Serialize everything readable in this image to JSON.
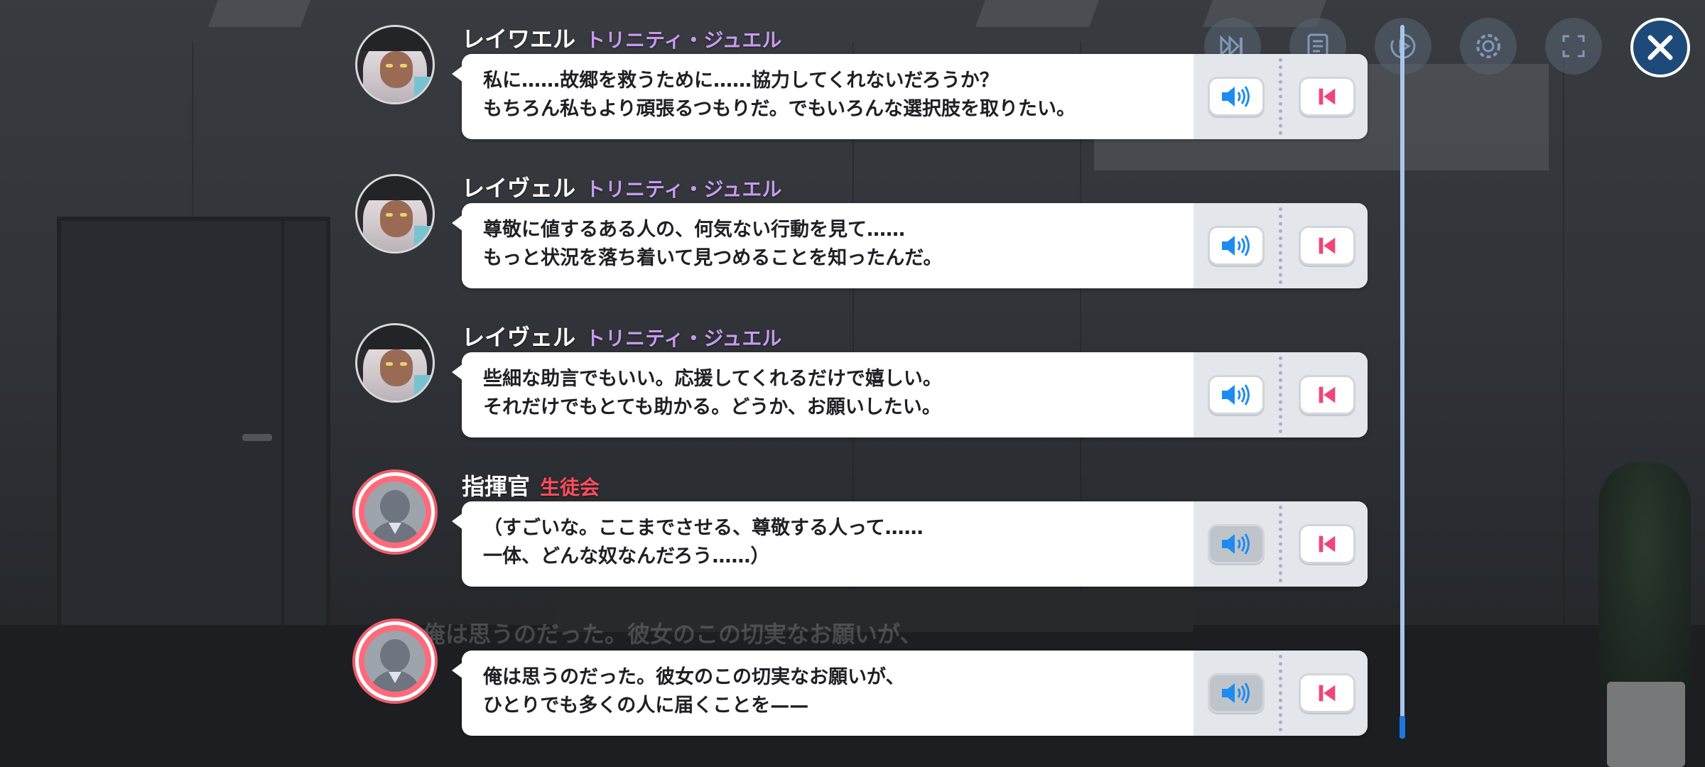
{
  "toolbar": {
    "buttons": [
      {
        "name": "skip-icon"
      },
      {
        "name": "log-icon"
      },
      {
        "name": "auto-play-icon"
      },
      {
        "name": "settings-icon"
      },
      {
        "name": "fullscreen-icon"
      }
    ],
    "close": {
      "name": "close-icon"
    }
  },
  "entries": [
    {
      "speaker": "レイワエル",
      "affiliation": "トリニティ・ジュエル",
      "affiliation_color": "#c89af0",
      "lines": [
        "私に……故郷を救うために……協力してくれないだろうか？",
        "もちろん私もより頑張るつもりだ。でもいろんな選択肢を取りたい。"
      ],
      "voice_enabled": true
    },
    {
      "speaker": "レイヴェル",
      "affiliation": "トリニティ・ジュエル",
      "affiliation_color": "#c89af0",
      "lines": [
        "尊敬に値するある人の、何気ない行動を見て……",
        "もっと状況を落ち着いて見つめることを知ったんだ。"
      ],
      "voice_enabled": true
    },
    {
      "speaker": "レイヴェル",
      "affiliation": "トリニティ・ジュエル",
      "affiliation_color": "#c89af0",
      "lines": [
        "些細な助言でもいい。応援してくれるだけで嬉しい。",
        "それだけでもとても助かる。どうか、お願いしたい。"
      ],
      "voice_enabled": true
    },
    {
      "speaker": "指揮官",
      "affiliation": "生徒会",
      "affiliation_color": "#ff4d5e",
      "lines": [
        "（すごいな。ここまでさせる、尊敬する人って……",
        "一体、どんな奴なんだろう……）"
      ],
      "voice_enabled": false
    },
    {
      "speaker": "",
      "affiliation": "",
      "affiliation_color": "#ff4d5e",
      "lines": [
        "俺は思うのだった。彼女のこの切実なお願いが、",
        "ひとりでも多くの人に届くことを——"
      ],
      "voice_enabled": false
    }
  ],
  "background_text": "俺は思うのだった。彼女のこの切実なお願いが、",
  "colors": {
    "accent_blue": "#1d8cf0",
    "rewind_pink": "#f0447a",
    "close_bg": "#1e4a7a"
  }
}
